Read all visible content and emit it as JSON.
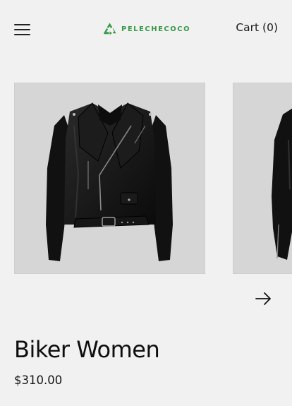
{
  "header": {
    "brand": "PELECHECOCO",
    "cart_label": "Cart (0)"
  },
  "product": {
    "title": "Biker Women",
    "price": "$310.00",
    "image_count_visible": 2
  },
  "colors": {
    "background": "#f1f1f1",
    "brand_green": "#3a9a4a",
    "image_bg": "#d6d6d6",
    "text": "#111111"
  },
  "icons": {
    "menu": "hamburger-icon",
    "logo": "recycle-logo-icon",
    "next": "arrow-right-icon"
  }
}
